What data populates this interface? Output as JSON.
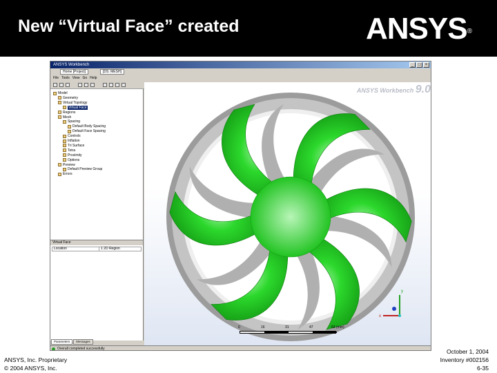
{
  "slide": {
    "title": "New “Virtual Face” created",
    "logo": "ANSYS",
    "logo_mark": "®",
    "footer_left": [
      "ANSYS, Inc. Proprietary",
      "© 2004 ANSYS, Inc."
    ],
    "footer_right": [
      "October 1, 2004",
      "Inventory #002156",
      "6-35"
    ]
  },
  "window": {
    "title": "ANSYS Workbench",
    "tabs": [
      "Home [Project]",
      "[DS: MESH]"
    ],
    "menu": [
      "File",
      "Tools",
      "View",
      "Go",
      "Help"
    ],
    "brand": "ANSYS Workbench",
    "version": "9.0"
  },
  "tree": {
    "items": [
      {
        "label": "Model",
        "indent": 0
      },
      {
        "label": "Geometry",
        "indent": 1
      },
      {
        "label": "Virtual Topology",
        "indent": 1
      },
      {
        "label": "Virtual Face",
        "indent": 2,
        "selected": true
      },
      {
        "label": "Regions",
        "indent": 1
      },
      {
        "label": "Mesh",
        "indent": 1
      },
      {
        "label": "Spacing",
        "indent": 2
      },
      {
        "label": "Default Body Spacing",
        "indent": 3
      },
      {
        "label": "Default Face Spacing",
        "indent": 3
      },
      {
        "label": "Controls",
        "indent": 2
      },
      {
        "label": "Inflation",
        "indent": 2
      },
      {
        "label": "Tri Surface",
        "indent": 2
      },
      {
        "label": "Tetra",
        "indent": 2
      },
      {
        "label": "Proximity",
        "indent": 2
      },
      {
        "label": "Options",
        "indent": 2
      },
      {
        "label": "Preview",
        "indent": 1
      },
      {
        "label": "Default Preview Group",
        "indent": 2
      },
      {
        "label": "Errors",
        "indent": 1
      }
    ]
  },
  "details": {
    "header": "Virtual Face",
    "rows": [
      {
        "key": "Location",
        "value": "1 2D Region"
      }
    ]
  },
  "bottom_tabs": [
    "Parameters",
    "Messages"
  ],
  "status": "Overall completed successfully",
  "scale": {
    "labels": [
      "0",
      "16",
      "31",
      "47",
      "63 (mm)"
    ]
  },
  "triad": {
    "x": "x",
    "y": "y"
  },
  "colors": {
    "face": "#1ec81e",
    "housing": "#a7a7a7",
    "header": "#000000"
  }
}
